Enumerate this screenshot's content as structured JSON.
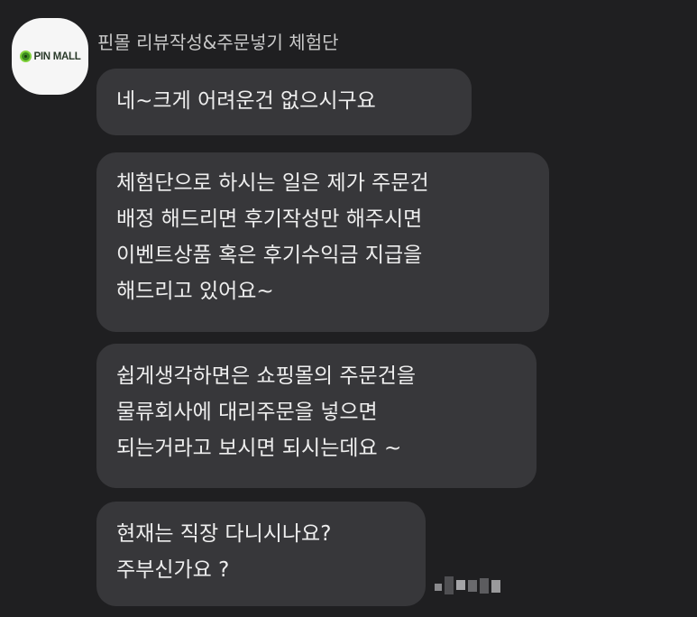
{
  "sender": {
    "name": "핀몰 리뷰작성&주문넣기 체험단",
    "avatar_logo_text": "PIN MALL",
    "logo_color": "#7fd13a"
  },
  "messages": [
    {
      "lines": [
        "네~크게 어려운건 없으시구요"
      ]
    },
    {
      "lines": [
        "체험단으로 하시는 일은 제가 주문건",
        "배정 해드리면 후기작성만 해주시면",
        "이벤트상품 혹은 후기수익금 지급을",
        "해드리고 있어요~"
      ]
    },
    {
      "lines": [
        "쉽게생각하면은 쇼핑몰의 주문건을",
        "물류회사에 대리주문을 넣으면",
        "되는거라고 보시면 되시는데요 ~"
      ]
    },
    {
      "lines": [
        "현재는 직장 다니시나요?",
        "주부신가요 ?"
      ]
    }
  ],
  "colors": {
    "background": "#1f1f21",
    "bubble": "#37373a",
    "text": "#eeeeee"
  }
}
